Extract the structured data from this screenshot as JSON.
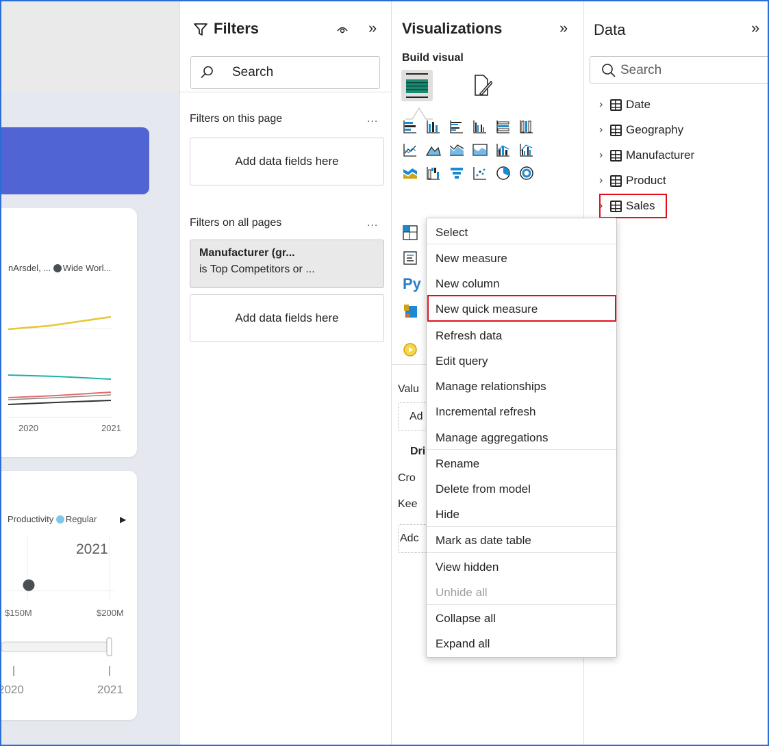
{
  "canvas": {
    "card1": {
      "legend": "nArsdel, ... ",
      "legend2": "Wide Worl...",
      "x_ticks": [
        "2020",
        "2021"
      ]
    },
    "card2": {
      "legend": "Productivity",
      "legend2": "Regular",
      "year_label": "2021",
      "x_ticks": [
        "$150M",
        "$200M"
      ],
      "slider_ticks": [
        "2020",
        "2021"
      ]
    }
  },
  "filters": {
    "title": "Filters",
    "search_placeholder": "Search",
    "page_section": "Filters on this page",
    "page_dropzone": "Add data fields here",
    "all_pages_section": "Filters on all pages",
    "card_title": "Manufacturer (gr...",
    "card_desc": "is Top Competitors or ...",
    "all_pages_dropzone": "Add data fields here",
    "more": "..."
  },
  "visualizations": {
    "title": "Visualizations",
    "build_visual": "Build visual",
    "python": "Py",
    "partial_labels": [
      "Valu",
      "Ad",
      "Dril",
      "Cro",
      "Kee",
      "Adc"
    ]
  },
  "data": {
    "title": "Data",
    "search_placeholder": "Search",
    "tables": [
      "Date",
      "Geography",
      "Manufacturer",
      "Product",
      "Sales"
    ]
  },
  "context_menu": {
    "items": [
      "Select",
      "New measure",
      "New column",
      "New quick measure",
      "Refresh data",
      "Edit query",
      "Manage relationships",
      "Incremental refresh",
      "Manage aggregations",
      "Rename",
      "Delete from model",
      "Hide",
      "Mark as date table",
      "View hidden",
      "Unhide all",
      "Collapse all",
      "Expand all"
    ],
    "highlighted": "New quick measure",
    "disabled": [
      "Unhide all"
    ]
  },
  "colors": {
    "banner": "#5064d4",
    "highlight": "#e0101b",
    "line_yellow": "#e8c532",
    "line_teal": "#1ab3a6",
    "line_red": "#e66c6c",
    "line_dark": "#333333",
    "dot_dark": "#4a4f55",
    "dot_regular": "#7fc7e8"
  }
}
